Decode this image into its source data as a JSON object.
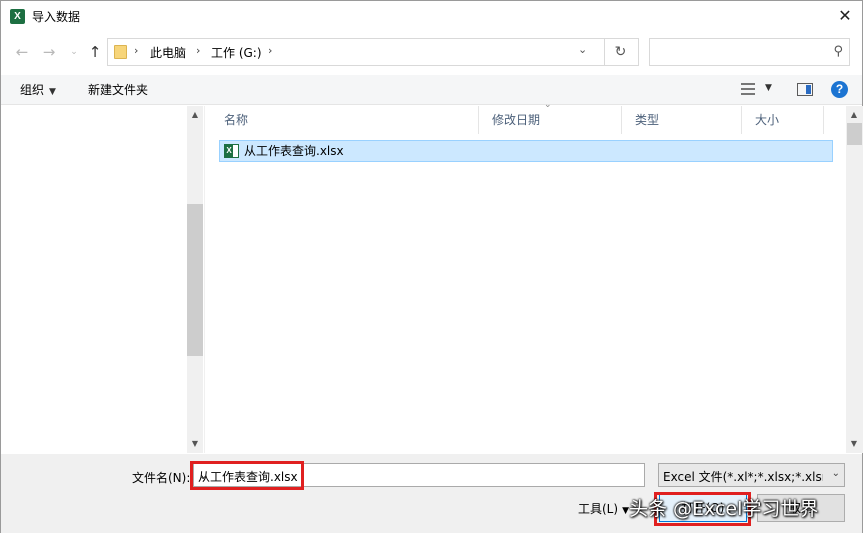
{
  "window": {
    "title": "导入数据",
    "app_icon": "excel-icon"
  },
  "nav": {
    "back_icon": "arrow-left-icon",
    "forward_icon": "arrow-right-icon",
    "history_icon": "chevron-down-icon",
    "up_icon": "arrow-up-icon"
  },
  "address": {
    "crumbs": [
      "此电脑",
      "工作 (G:)"
    ]
  },
  "search": {
    "placeholder": ""
  },
  "toolbar": {
    "organize_label": "组织",
    "new_folder_label": "新建文件夹"
  },
  "columns": {
    "name": "名称",
    "modified": "修改日期",
    "type": "类型",
    "size": "大小"
  },
  "files": [
    {
      "name": "从工作表查询.xlsx"
    }
  ],
  "bottom": {
    "filename_label": "文件名(N):",
    "filename_value": "从工作表查询.xlsx",
    "filetype_value": "Excel 文件(*.xl*;*.xlsx;*.xlsm;*.",
    "tools_label": "工具(L)",
    "open_label": "打开(O)",
    "cancel_label": "取消"
  },
  "watermark": {
    "text": "头条 @Excel学习世界"
  },
  "colors": {
    "accent": "#0078d7",
    "selection": "#cce8ff",
    "highlight_box": "#e02020",
    "excel_green": "#1d6f42"
  }
}
